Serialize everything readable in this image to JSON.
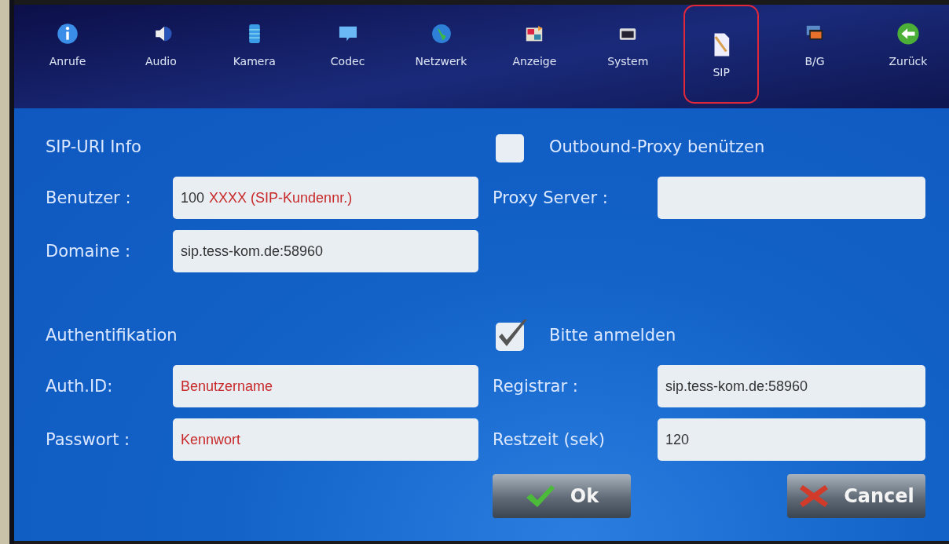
{
  "tabs": [
    {
      "label": "Anrufe",
      "selected": false
    },
    {
      "label": "Audio",
      "selected": false
    },
    {
      "label": "Kamera",
      "selected": false
    },
    {
      "label": "Codec",
      "selected": false
    },
    {
      "label": "Netzwerk",
      "selected": false
    },
    {
      "label": "Anzeige",
      "selected": false
    },
    {
      "label": "System",
      "selected": false
    },
    {
      "label": "SIP",
      "selected": true
    },
    {
      "label": "B/G",
      "selected": false
    },
    {
      "label": "Zurück",
      "selected": false
    }
  ],
  "sip_uri": {
    "title": "SIP-URI Info",
    "fields": [
      {
        "label": "Benutzer :",
        "parts": [
          {
            "text": "100",
            "kind": "value"
          },
          {
            "text": "XXXX (SIP-Kundennr.)",
            "kind": "hint"
          }
        ]
      },
      {
        "label": "Domaine :",
        "parts": [
          {
            "text": "sip.tess-kom.de:58960",
            "kind": "value"
          }
        ]
      }
    ]
  },
  "proxy": {
    "label": "Outbound-Proxy benützen",
    "checked": false,
    "fields": [
      {
        "label": "Proxy Server :"
      }
    ]
  },
  "auth": {
    "title": "Authentifikation",
    "fields": [
      {
        "label": "Auth.ID:",
        "parts": [
          {
            "text": "Benutzername",
            "kind": "hint"
          }
        ]
      },
      {
        "label": "Passwort :",
        "parts": [
          {
            "text": "Kennwort",
            "kind": "hint"
          }
        ]
      }
    ]
  },
  "register": {
    "label": "Bitte anmelden",
    "checked": true,
    "fields": [
      {
        "label": "Registrar :",
        "parts": [
          {
            "text": "sip.tess-kom.de:58960",
            "kind": "value"
          }
        ]
      },
      {
        "label": "Restzeit (sek)",
        "parts": [
          {
            "text": "120",
            "kind": "value"
          }
        ]
      }
    ]
  },
  "buttons": [
    {
      "label": "Ok",
      "kind": "ok"
    },
    {
      "label": "Cancel",
      "kind": "cancel"
    }
  ]
}
